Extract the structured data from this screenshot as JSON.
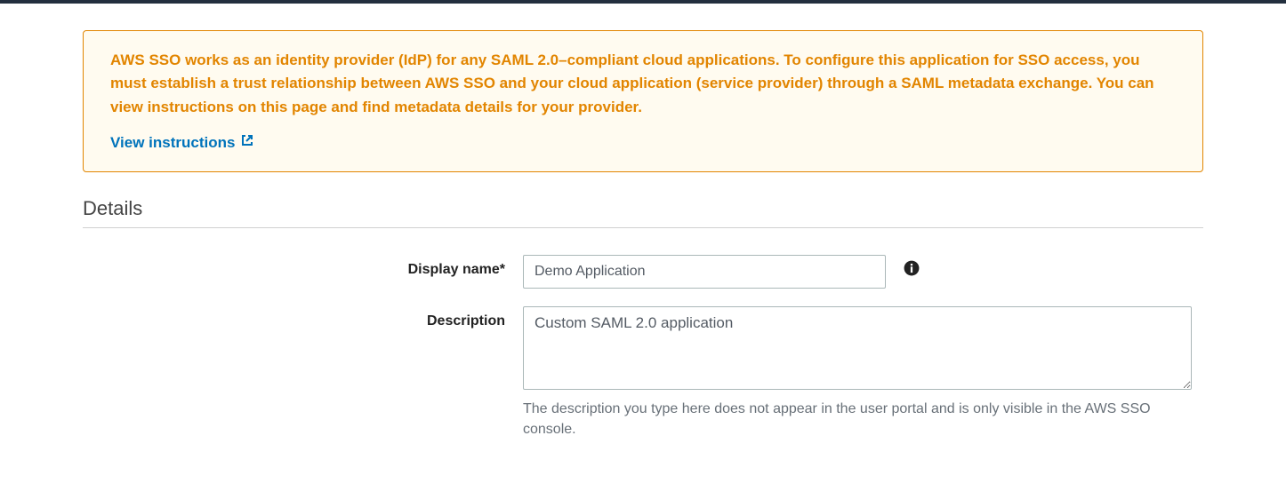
{
  "infoBox": {
    "text": "AWS SSO works as an identity provider (IdP) for any SAML 2.0–compliant cloud applications. To configure this application for SSO access, you must establish a trust relationship between AWS SSO and your cloud application (service provider) through a SAML metadata exchange. You can view instructions on this page and find metadata details for your provider.",
    "linkLabel": "View instructions"
  },
  "section": {
    "title": "Details"
  },
  "form": {
    "displayName": {
      "label": "Display name*",
      "value": "Demo Application"
    },
    "description": {
      "label": "Description",
      "value": "Custom SAML 2.0 application",
      "help": "The description you type here does not appear in the user portal and is only visible in the AWS SSO console."
    }
  }
}
